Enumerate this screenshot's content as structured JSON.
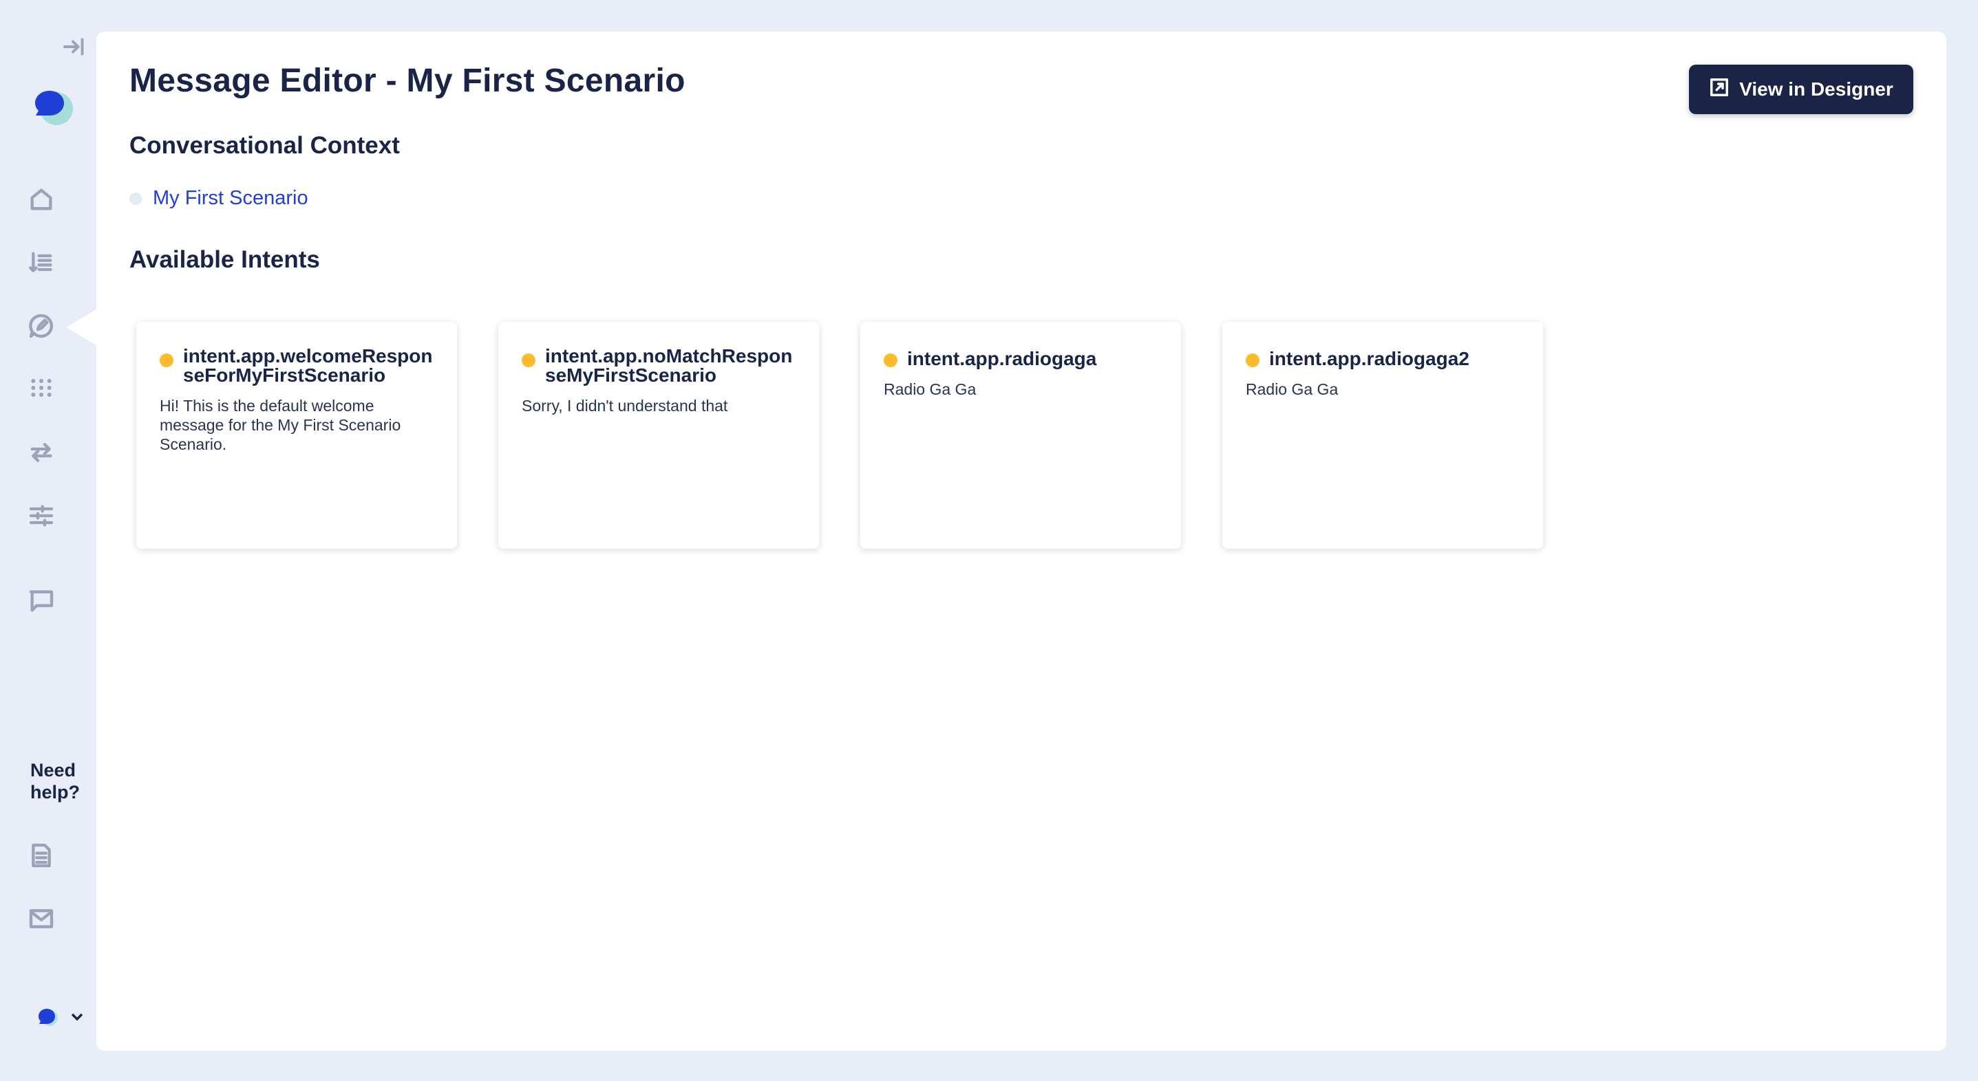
{
  "sidebar": {
    "icons": [
      "collapse-sidebar-icon",
      "home-icon",
      "list-sort-icon",
      "message-editor-icon",
      "apps-grid-icon",
      "swap-icon",
      "sliders-icon",
      "chat-icon",
      "document-icon",
      "mail-icon"
    ],
    "need_help": "Need help?"
  },
  "header": {
    "title": "Message Editor - My First Scenario",
    "designer_button_label": "View in Designer"
  },
  "conversational_context": {
    "heading": "Conversational Context",
    "items": [
      {
        "label": "My First Scenario"
      }
    ]
  },
  "available_intents": {
    "heading": "Available Intents",
    "cards": [
      {
        "name": "intent.app.welcomeResponseForMyFirstScenario",
        "message": "Hi! This is the default welcome message for the My First Scenario Scenario."
      },
      {
        "name": "intent.app.noMatchResponseMyFirstScenario",
        "message": "Sorry, I didn't understand that"
      },
      {
        "name": "intent.app.radiogaga",
        "message": "Radio Ga Ga"
      },
      {
        "name": "intent.app.radiogaga2",
        "message": "Radio Ga Ga"
      }
    ]
  },
  "colors": {
    "accent": "#1a2447",
    "status_dot": "#fbbc2b",
    "link": "#1f3fd6",
    "background": "#e9edf7"
  }
}
